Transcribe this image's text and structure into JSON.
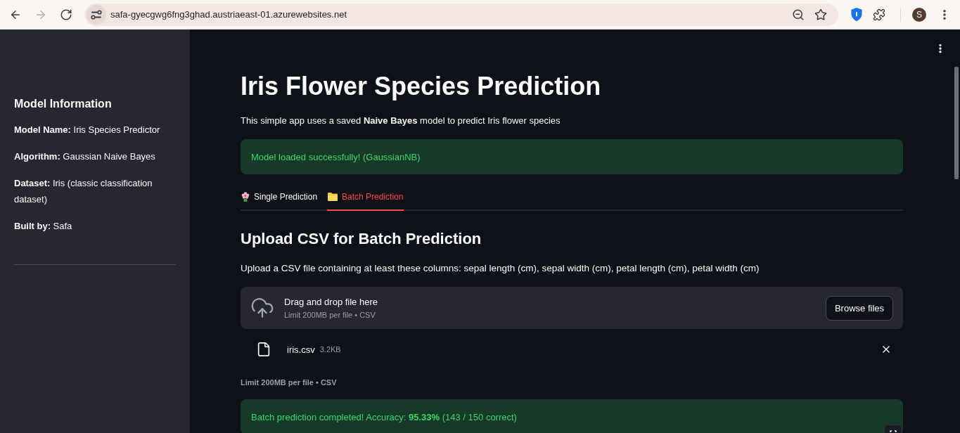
{
  "browser": {
    "nav_buttons": [
      {
        "kind": "back",
        "disabled": false
      },
      {
        "kind": "forward",
        "disabled": true
      },
      {
        "kind": "reload",
        "disabled": false
      }
    ],
    "url": "safa-gyecgwg6fng3ghad.austriaeast-01.azurewebsites.net",
    "avatar": "S"
  },
  "sidebar": {
    "title": "Model Information",
    "items": [
      "**Model Name:** Iris Species Predictor",
      "**Algorithm:** Gaussian Naive Bayes",
      "**Dataset:** Iris (classic classification dataset)",
      "**Built by:** Safa"
    ]
  },
  "main": {
    "title": "Iris Flower Species Prediction",
    "intro": "This simple app uses a saved **Naive Bayes** model to predict Iris flower species",
    "model_status": {
      "kind": "success",
      "message": "Model loaded successfully! (GaussianNB)"
    },
    "tabs": [
      {
        "label": "Single Prediction",
        "selected": false
      },
      {
        "label": "Batch Prediction",
        "selected": true
      }
    ],
    "upload_section": {
      "heading": "Upload CSV for Batch Prediction",
      "description": "Upload a CSV file containing at least these columns: sepal length (cm), sepal width (cm), petal length (cm), petal width (cm)",
      "dropzone": {
        "title": "Drag and drop file here",
        "hint": "Limit 200MB per file • CSV",
        "button": "Browse files"
      },
      "files": [
        {
          "name": "iris.csv",
          "size": "3.2KB"
        }
      ],
      "limit_note": "Limit 200MB per file • CSV",
      "result": {
        "kind": "success",
        "message": "Batch prediction completed! Accuracy: **95.33%** (143 / 150 correct)"
      }
    }
  }
}
